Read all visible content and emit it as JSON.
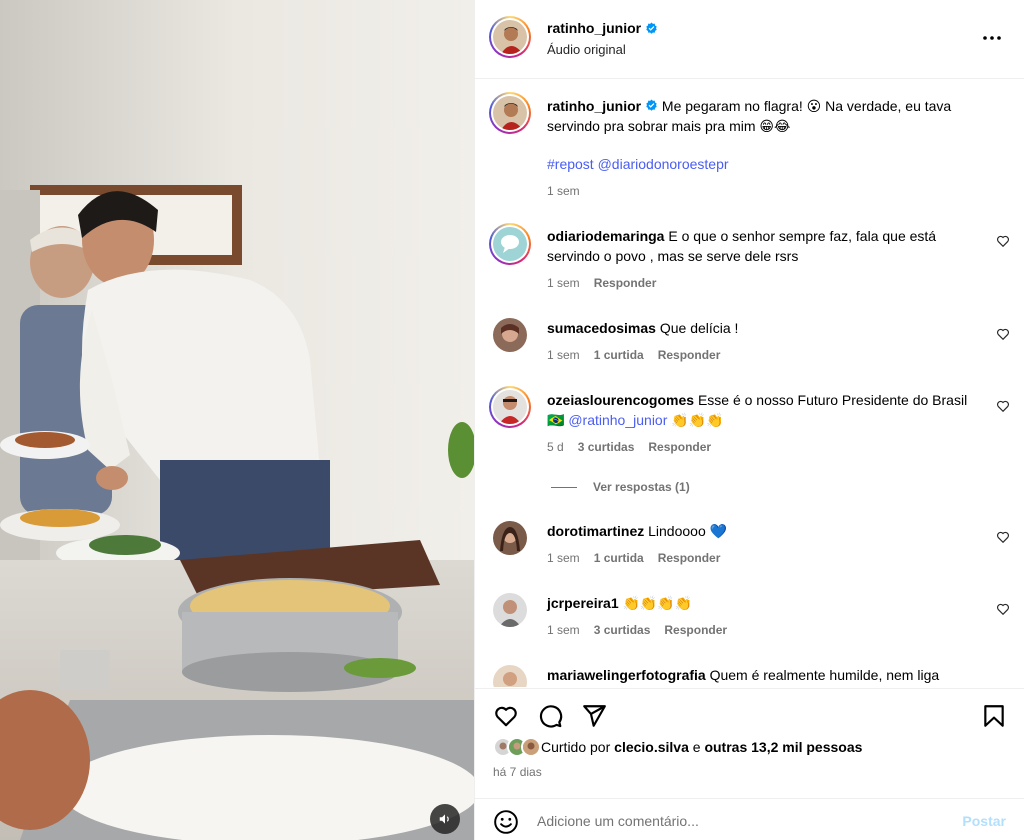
{
  "post": {
    "author": "ratinho_junior",
    "audio": "Áudio original",
    "caption": {
      "text": "Me pegaram no flagra! 😮 Na verdade, eu tava servindo pra sobrar mais pra mim 😁😂",
      "hashtags": "#repost @diariodonoroestepr",
      "time": "1 sem"
    }
  },
  "comments": [
    {
      "user": "odiariodemaringa",
      "text": "E o que o senhor sempre faz, fala que está servindo o povo , mas se serve dele rsrs",
      "time": "1 sem",
      "likes": "",
      "reply": "Responder"
    },
    {
      "user": "sumacedosimas",
      "text": "Que delícia !",
      "time": "1 sem",
      "likes": "1 curtida",
      "reply": "Responder"
    },
    {
      "user": "ozeiaslourencogomes",
      "text": "Esse é o nosso Futuro Presidente do Brasil 🇧🇷",
      "mention": "@ratinho_junior",
      "emoji": "👏👏👏",
      "time": "5 d",
      "likes": "3 curtidas",
      "reply": "Responder"
    },
    {
      "user": "dorotimartinez",
      "text": "Lindoooo 💙",
      "time": "1 sem",
      "likes": "1 curtida",
      "reply": "Responder"
    },
    {
      "user": "jcrpereira1",
      "text": "👏👏👏👏",
      "time": "1 sem",
      "likes": "3 curtidas",
      "reply": "Responder"
    },
    {
      "user": "mariawelingerfotografia",
      "text": "Quem é realmente humilde, nem liga",
      "time": "",
      "likes": "",
      "reply": ""
    }
  ],
  "view_replies": "Ver respostas (1)",
  "likes": {
    "prefix": "Curtido por",
    "first": "clecio.silva",
    "middle": "e",
    "others": "outras 13,2 mil pessoas"
  },
  "posted": "há 7 dias",
  "composer": {
    "placeholder": "Adicione um comentário...",
    "post_label": "Postar"
  },
  "icons": {
    "more": "more-horizontal-icon",
    "like": "heart-icon",
    "comment": "comment-icon",
    "share": "share-icon",
    "save": "bookmark-icon",
    "emoji": "emoji-icon",
    "sound": "speaker-icon",
    "verified": "verified-badge-icon"
  },
  "colors": {
    "link": "#4a5df2",
    "verified": "#0095f6",
    "secondary_text": "#737373",
    "post_button_disabled": "#b2dffc"
  }
}
